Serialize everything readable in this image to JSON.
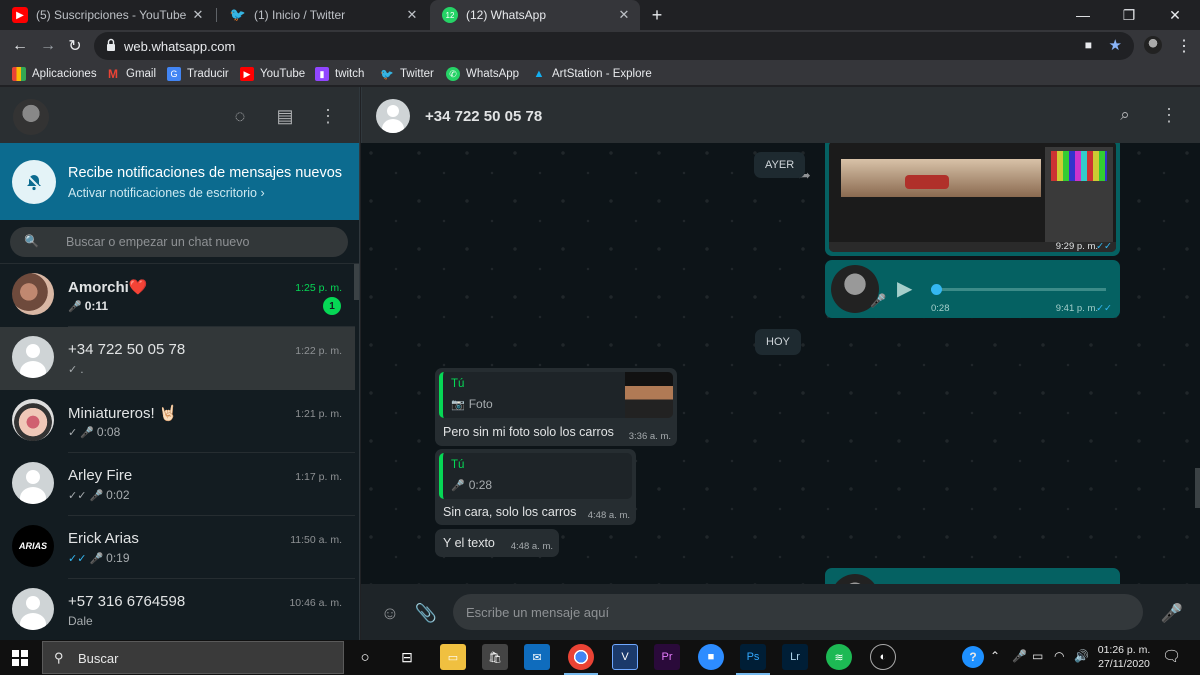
{
  "browser": {
    "tabs": [
      {
        "title": "(5) Suscripciones - YouTube",
        "icon": "youtube-icon"
      },
      {
        "title": "(1) Inicio / Twitter",
        "icon": "twitter-icon"
      },
      {
        "title": "(12) WhatsApp",
        "icon": "whatsapp-icon",
        "badge": "12"
      }
    ],
    "new_tab_label": "+",
    "url": "web.whatsapp.com",
    "bookmarks": [
      {
        "label": "Aplicaciones",
        "icon": "apps-grid-icon"
      },
      {
        "label": "Gmail",
        "icon": "gmail-icon"
      },
      {
        "label": "Traducir",
        "icon": "translate-icon"
      },
      {
        "label": "YouTube",
        "icon": "youtube-icon"
      },
      {
        "label": "twitch",
        "icon": "twitch-icon"
      },
      {
        "label": "Twitter",
        "icon": "twitter-icon"
      },
      {
        "label": "WhatsApp",
        "icon": "whatsapp-icon"
      },
      {
        "label": "ArtStation - Explore",
        "icon": "artstation-icon"
      }
    ]
  },
  "sidebar": {
    "notification": {
      "title": "Recibe notificaciones de mensajes nuevos",
      "action": "Activar notificaciones de escritorio ›"
    },
    "search_placeholder": "Buscar o empezar un chat nuevo",
    "chats": [
      {
        "name": "Amorchi❤️",
        "time": "1:25 p. m.",
        "preview": "0:11",
        "unread": "1"
      },
      {
        "name": "+34 722 50 05 78",
        "time": "1:22 p. m.",
        "preview": "."
      },
      {
        "name": "Miniatureros! 🤘🏻",
        "time": "1:21 p. m.",
        "preview": "0:08"
      },
      {
        "name": "Arley Fire",
        "time": "1:17 p. m.",
        "preview": "0:02"
      },
      {
        "name": "Erick Arias",
        "time": "11:50 a. m.",
        "preview": "0:19"
      },
      {
        "name": "+57 316 6764598",
        "time": "10:46 a. m.",
        "preview": "Dale"
      }
    ]
  },
  "conversation": {
    "contact": "+34 722 50 05 78",
    "day_ayer": "AYER",
    "day_hoy": "HOY",
    "image_msg_time": "9:29 p. m.",
    "voice_msg": {
      "duration": "0:28",
      "time": "9:41 p. m.",
      "progress": 0
    },
    "messages": [
      {
        "quote_author": "Tú",
        "quote_text": "Foto",
        "text": "Pero sin mi foto solo los carros",
        "time": "3:36 a. m."
      },
      {
        "quote_author": "Tú",
        "quote_text": "0:28",
        "text": "Sin cara, solo los carros",
        "time": "4:48 a. m."
      },
      {
        "text": "Y el texto",
        "time": "4:48 a. m."
      }
    ],
    "input_placeholder": "Escribe un mensaje aquí"
  },
  "taskbar": {
    "search_label": "Buscar",
    "date_time": {
      "time": "01:26 p. m.",
      "date": "27/11/2020"
    }
  },
  "colors": {
    "accent_green": "#06d755",
    "outgoing_bubble": "#056162",
    "notification_banner": "#0c6b8f",
    "read_tick": "#34b7f1"
  }
}
